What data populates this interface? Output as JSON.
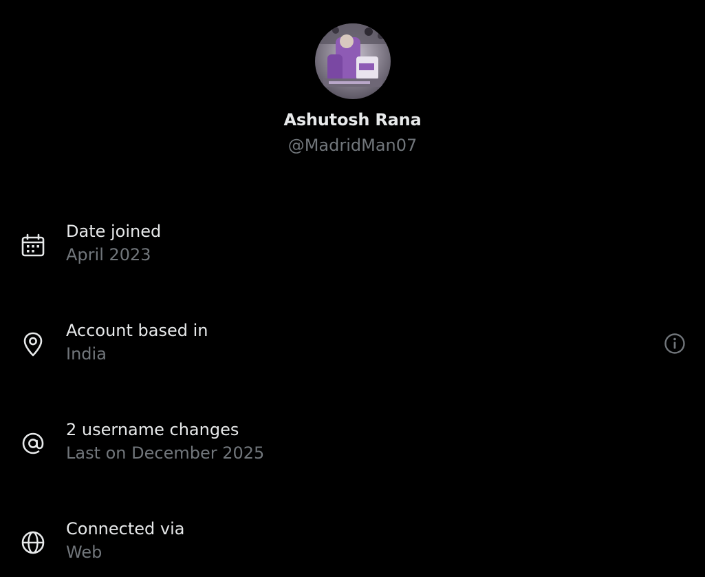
{
  "profile": {
    "display_name": "Ashutosh Rana",
    "handle": "@MadridMan07",
    "avatar_icon": "profile-photo"
  },
  "about": {
    "date_joined": {
      "icon": "calendar-icon",
      "title": "Date joined",
      "value": "April 2023"
    },
    "location": {
      "icon": "location-pin-icon",
      "title": "Account based in",
      "value": "India",
      "info_icon": "info-icon"
    },
    "username_changes": {
      "icon": "at-sign-icon",
      "title": "2 username changes",
      "value": "Last on December 2025"
    },
    "connected_via": {
      "icon": "globe-icon",
      "title": "Connected via",
      "value": "Web"
    }
  },
  "colors": {
    "background": "#000000",
    "primary_text": "#e7e9ea",
    "secondary_text": "#71767b",
    "avatar_accent": "#8e5bb5"
  }
}
